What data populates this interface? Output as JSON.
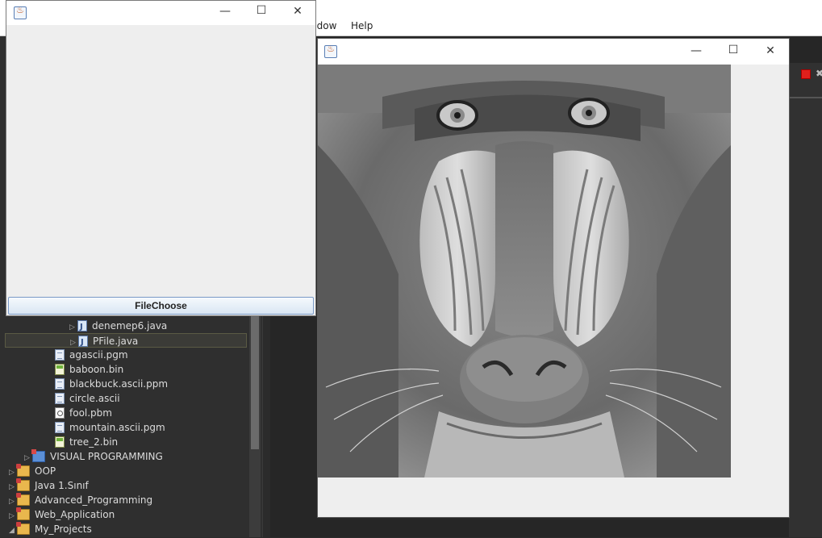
{
  "ide": {
    "menu_window": "ndow",
    "menu_help": "Help"
  },
  "tree": {
    "items": [
      {
        "label": "denemep6.java",
        "icon": "java-file-icon"
      },
      {
        "label": "PFile.java",
        "icon": "java-file-icon"
      },
      {
        "label": "agascii.pgm",
        "icon": "text-file-icon"
      },
      {
        "label": "baboon.bin",
        "icon": "binary-file-icon"
      },
      {
        "label": "blackbuck.ascii.ppm",
        "icon": "text-file-icon"
      },
      {
        "label": "circle.ascii",
        "icon": "text-file-icon"
      },
      {
        "label": "fool.pbm",
        "icon": "image-file-icon"
      },
      {
        "label": "mountain.ascii.pgm",
        "icon": "text-file-icon"
      },
      {
        "label": "tree_2.bin",
        "icon": "binary-file-icon"
      },
      {
        "label": "VISUAL PROGRAMMING",
        "icon": "project-icon"
      },
      {
        "label": "OOP",
        "icon": "project-icon"
      },
      {
        "label": "Java 1.Sınıf",
        "icon": "project-icon"
      },
      {
        "label": "Advanced_Programming",
        "icon": "project-icon"
      },
      {
        "label": "Web_Application",
        "icon": "project-icon"
      },
      {
        "label": "My_Projects",
        "icon": "project-icon"
      }
    ]
  },
  "file_window": {
    "button_label": "FileChoose",
    "minimize": "—",
    "maximize": "☐",
    "close": "✕"
  },
  "image_window": {
    "minimize": "—",
    "maximize": "☐",
    "close": "✕",
    "image_subject": "grayscale baboon (mandrill) face"
  },
  "colors": {
    "stop_button": "#e0201c",
    "button_border": "#7a9ac7"
  }
}
